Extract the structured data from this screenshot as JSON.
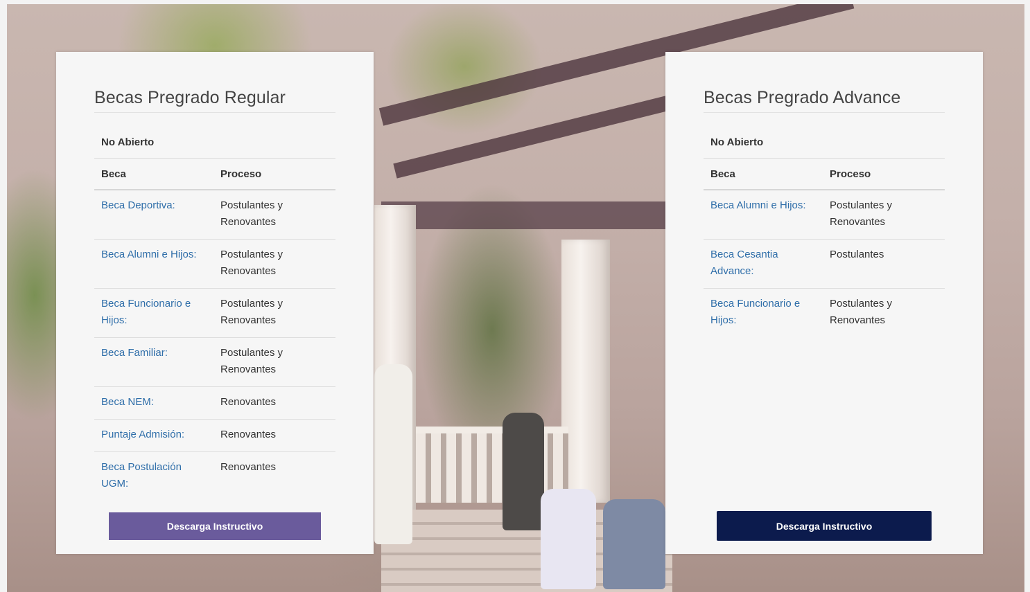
{
  "left_card": {
    "title": "Becas Pregrado Regular",
    "status": "No Abierto",
    "headers": {
      "beca": "Beca",
      "proceso": "Proceso"
    },
    "rows": [
      {
        "beca": "Beca Deportiva:",
        "proceso": "Postulantes y Renovantes"
      },
      {
        "beca": "Beca Alumni e Hijos:",
        "proceso": "Postulantes y Renovantes"
      },
      {
        "beca": "Beca Funcionario e Hijos:",
        "proceso": "Postulantes y Renovantes"
      },
      {
        "beca": "Beca Familiar:",
        "proceso": "Postulantes y Renovantes"
      },
      {
        "beca": "Beca NEM:",
        "proceso": "Renovantes"
      },
      {
        "beca": "Puntaje Admisión:",
        "proceso": "Renovantes"
      },
      {
        "beca": "Beca Postulación UGM:",
        "proceso": "Renovantes"
      }
    ],
    "button_label": "Descarga Instructivo",
    "button_color": "#6a5b9c"
  },
  "right_card": {
    "title": "Becas Pregrado Advance",
    "status": "No Abierto",
    "headers": {
      "beca": "Beca",
      "proceso": "Proceso"
    },
    "rows": [
      {
        "beca": "Beca Alumni e Hijos:",
        "proceso": "Postulantes y Renovantes"
      },
      {
        "beca": "Beca Cesantia Advance:",
        "proceso": "Postulantes"
      },
      {
        "beca": "Beca Funcionario e Hijos:",
        "proceso": "Postulantes y Renovantes"
      }
    ],
    "button_label": "Descarga Instructivo",
    "button_color": "#0c1b4d"
  },
  "colors": {
    "link": "#2f6ea9",
    "card_bg": "#f6f6f6",
    "text": "#333333"
  }
}
